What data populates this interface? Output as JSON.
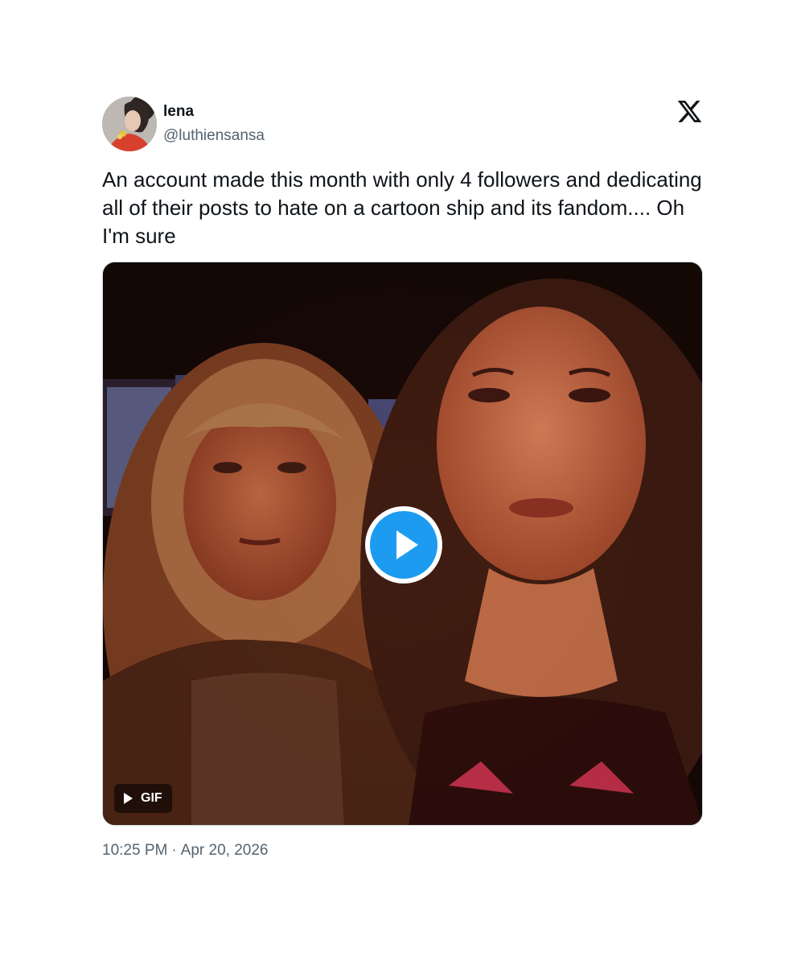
{
  "author": {
    "display_name": "lena",
    "handle": "@luthiensansa"
  },
  "tweet": {
    "text": "An account made this month with only 4 followers and dedicating all of their posts to hate on a cartoon ship and its fandom.... Oh I'm sure"
  },
  "media": {
    "badge_label": "GIF",
    "play_icon": "play-icon"
  },
  "meta": {
    "time": "10:25 PM",
    "separator": "·",
    "date": "Apr 20, 2026"
  },
  "icons": {
    "brand": "x-logo-icon"
  },
  "colors": {
    "accent": "#1d9bf0",
    "text_primary": "#0f1419",
    "text_secondary": "#536471",
    "border": "#cfd9de"
  }
}
